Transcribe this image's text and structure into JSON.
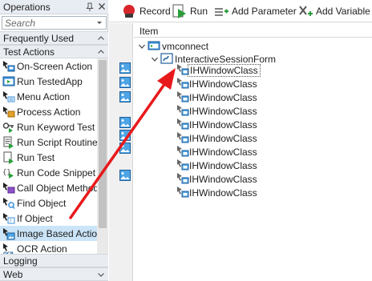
{
  "operations_panel": {
    "title": "Operations",
    "search_placeholder": "Search",
    "categories": {
      "frequently_used": "Frequently Used",
      "test_actions": "Test Actions",
      "logging": "Logging",
      "web": "Web"
    },
    "items": [
      {
        "label": "On-Screen Action",
        "icon": "on-screen-action-icon"
      },
      {
        "label": "Run TestedApp",
        "icon": "run-testedapp-icon"
      },
      {
        "label": "Menu Action",
        "icon": "menu-action-icon"
      },
      {
        "label": "Process Action",
        "icon": "process-action-icon"
      },
      {
        "label": "Run Keyword Test",
        "icon": "run-keyword-test-icon"
      },
      {
        "label": "Run Script Routine",
        "icon": "run-script-routine-icon"
      },
      {
        "label": "Run Test",
        "icon": "run-test-icon"
      },
      {
        "label": "Run Code Snippet",
        "icon": "run-code-snippet-icon"
      },
      {
        "label": "Call Object Method",
        "icon": "call-object-method-icon"
      },
      {
        "label": "Find Object",
        "icon": "find-object-icon"
      },
      {
        "label": "If Object",
        "icon": "if-object-icon"
      },
      {
        "label": "Image Based Action",
        "icon": "image-based-action-icon",
        "selected": true
      },
      {
        "label": "OCR Action",
        "icon": "ocr-action-icon"
      }
    ]
  },
  "toolbar": {
    "record": "Record",
    "run": "Run",
    "add_parameter": "Add Parameter",
    "add_variable": "Add Variable"
  },
  "tree": {
    "column_header": "Item",
    "root": "vmconnect",
    "form": "InteractiveSessionForm",
    "children": [
      "IHWindowClass",
      "IHWindowClass",
      "IHWindowClass",
      "IHWindowClass",
      "IHWindowClass",
      "IHWindowClass",
      "IHWindowClass",
      "IHWindowClass",
      "IHWindowClass",
      "IHWindowClass"
    ]
  },
  "colors": {
    "selection": "#cbe4f7",
    "arrow": "#e8191b",
    "panel_header": "#e8edf3"
  }
}
